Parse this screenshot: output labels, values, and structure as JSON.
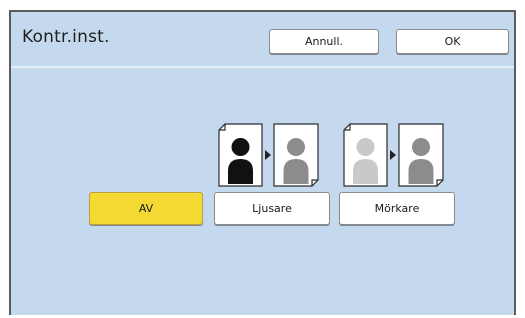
{
  "dialog": {
    "title": "Kontr.inst.",
    "cancel_label": "Annull.",
    "ok_label": "OK"
  },
  "options": [
    {
      "label": "AV",
      "selected": true
    },
    {
      "label": "Ljusare",
      "selected": false,
      "icon": "lighter-contrast-icon"
    },
    {
      "label": "Mörkare",
      "selected": false,
      "icon": "darker-contrast-icon"
    }
  ],
  "colors": {
    "panel_background": "#c5d9ee",
    "selected_button": "#f5d933",
    "button": "#ffffff"
  }
}
